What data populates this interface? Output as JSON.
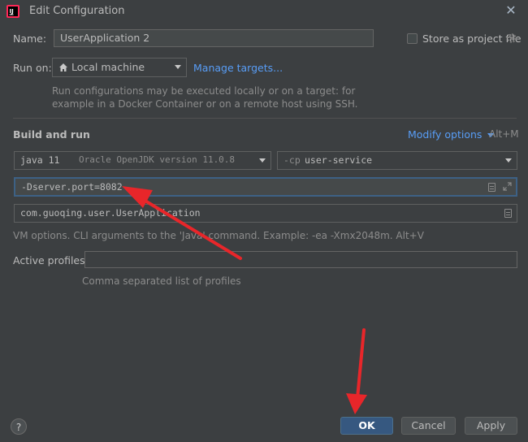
{
  "window": {
    "title": "Edit Configuration",
    "close_glyph": "✕"
  },
  "name_row": {
    "label": "Name:",
    "value": "UserApplication 2",
    "store_label": "Store as project file"
  },
  "run_on": {
    "label": "Run on:",
    "target": "Local machine",
    "manage_link": "Manage targets...",
    "hint_line1": "Run configurations may be executed locally or on a target: for",
    "hint_line2": "example in a Docker Container or on a remote host using SSH."
  },
  "build_run": {
    "heading": "Build and run",
    "modify_options": "Modify options",
    "modify_shortcut": "Alt+M",
    "jdk_name": "java 11",
    "jdk_detail": "Oracle OpenJDK version 11.0.8",
    "cp_prefix": "-cp",
    "cp_module": "user-service",
    "vm_options": "-Dserver.port=8082",
    "main_class": "com.guoqing.user.UserApplication",
    "vm_hint": "VM options. CLI arguments to the 'Java' command. Example: -ea -Xmx2048m. Alt+V"
  },
  "profiles": {
    "label": "Active profiles:",
    "value": "",
    "hint": "Comma separated list of profiles"
  },
  "buttons": {
    "help": "?",
    "ok": "OK",
    "cancel": "Cancel",
    "apply": "Apply"
  },
  "icons": [
    "app-icon",
    "close-icon",
    "gear-icon",
    "home-icon",
    "chevron-down-icon",
    "document-icon",
    "expand-icon",
    "annotation-arrow-icon"
  ],
  "colors": {
    "background": "#3c3f41",
    "link": "#589df6",
    "ok_button": "#365880",
    "annotation_arrow": "#e8262a",
    "focus_border": "#3d6185"
  }
}
